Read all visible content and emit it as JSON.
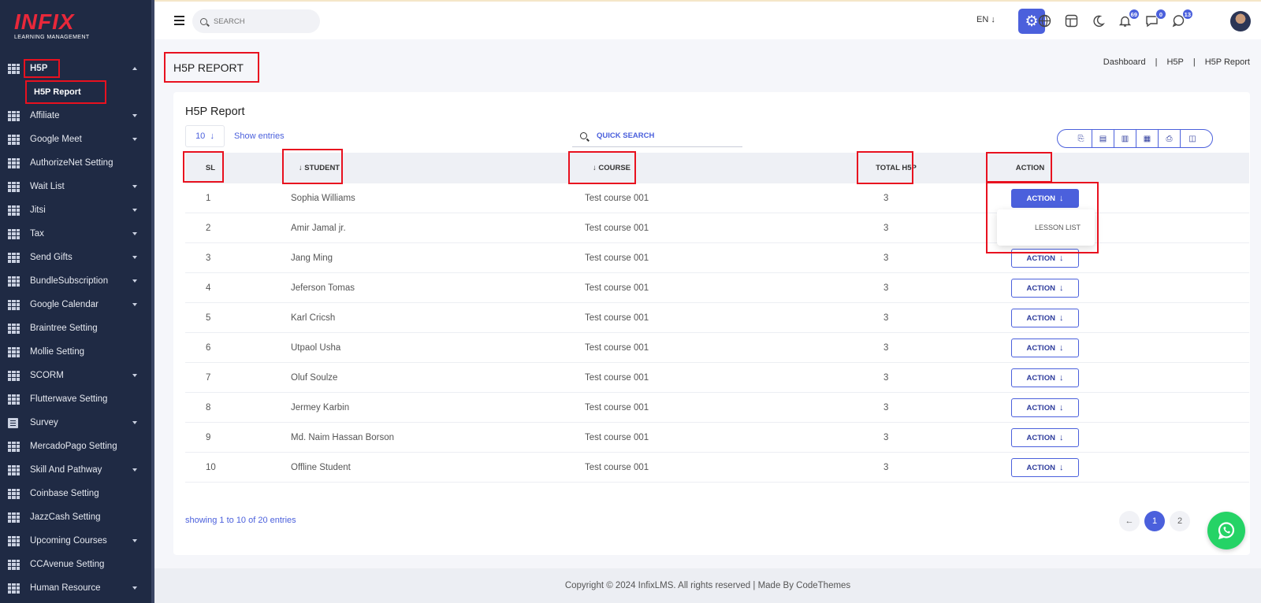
{
  "logo": {
    "main": "INFIX",
    "sub": "LEARNING MANAGEMENT"
  },
  "sidebar": {
    "items": [
      {
        "label": "H5P",
        "caret": "up",
        "icon": "grid-icon"
      },
      {
        "label": "Affiliate",
        "caret": "down",
        "icon": "grid-icon"
      },
      {
        "label": "Google Meet",
        "caret": "down",
        "icon": "grid-icon"
      },
      {
        "label": "AuthorizeNet Setting",
        "caret": "",
        "icon": "grid-icon"
      },
      {
        "label": "Wait List",
        "caret": "down",
        "icon": "grid-icon"
      },
      {
        "label": "Jitsi",
        "caret": "down",
        "icon": "grid-icon"
      },
      {
        "label": "Tax",
        "caret": "down",
        "icon": "grid-icon"
      },
      {
        "label": "Send Gifts",
        "caret": "down",
        "icon": "grid-icon"
      },
      {
        "label": "BundleSubscription",
        "caret": "down",
        "icon": "grid-icon"
      },
      {
        "label": "Google Calendar",
        "caret": "down",
        "icon": "grid-icon"
      },
      {
        "label": "Braintree Setting",
        "caret": "",
        "icon": "grid-icon"
      },
      {
        "label": "Mollie Setting",
        "caret": "",
        "icon": "grid-icon"
      },
      {
        "label": "SCORM",
        "caret": "down",
        "icon": "grid-icon"
      },
      {
        "label": "Flutterwave Setting",
        "caret": "",
        "icon": "grid-icon"
      },
      {
        "label": "Survey",
        "caret": "down",
        "icon": "doc-icon"
      },
      {
        "label": "MercadoPago Setting",
        "caret": "",
        "icon": "grid-icon"
      },
      {
        "label": "Skill And Pathway",
        "caret": "down",
        "icon": "grid-icon"
      },
      {
        "label": "Coinbase Setting",
        "caret": "",
        "icon": "grid-icon"
      },
      {
        "label": "JazzCash Setting",
        "caret": "",
        "icon": "grid-icon"
      },
      {
        "label": "Upcoming Courses",
        "caret": "down",
        "icon": "grid-icon"
      },
      {
        "label": "CCAvenue Setting",
        "caret": "",
        "icon": "grid-icon"
      },
      {
        "label": "Human Resource",
        "caret": "down",
        "icon": "grid-icon"
      }
    ],
    "sub_item": "H5P Report"
  },
  "topbar": {
    "search_placeholder": "SEARCH",
    "lang": "EN",
    "badges": {
      "notifications": "69",
      "messages": "0",
      "whatsapp": "13"
    }
  },
  "page": {
    "title": "H5P REPORT",
    "breadcrumb": [
      "Dashboard",
      "H5P",
      "H5P Report"
    ]
  },
  "card": {
    "title": "H5P Report",
    "entries_value": "10",
    "entries_label": "Show entries",
    "quick_search": "QUICK SEARCH",
    "columns": {
      "sl": "SL",
      "student": "STUDENT",
      "course": "COURSE",
      "total": "TOTAL H5P",
      "action": "ACTION"
    },
    "action_label": "ACTION",
    "dropdown_item": "LESSON LIST",
    "rows": [
      {
        "sl": "1",
        "student": "Sophia Williams",
        "course": "Test course 001",
        "total": "3"
      },
      {
        "sl": "2",
        "student": "Amir Jamal jr.",
        "course": "Test course 001",
        "total": "3"
      },
      {
        "sl": "3",
        "student": "Jang Ming",
        "course": "Test course 001",
        "total": "3"
      },
      {
        "sl": "4",
        "student": "Jeferson Tomas",
        "course": "Test course 001",
        "total": "3"
      },
      {
        "sl": "5",
        "student": "Karl Cricsh",
        "course": "Test course 001",
        "total": "3"
      },
      {
        "sl": "6",
        "student": "Utpaol Usha",
        "course": "Test course 001",
        "total": "3"
      },
      {
        "sl": "7",
        "student": "Oluf Soulze",
        "course": "Test course 001",
        "total": "3"
      },
      {
        "sl": "8",
        "student": "Jermey Karbin",
        "course": "Test course 001",
        "total": "3"
      },
      {
        "sl": "9",
        "student": "Md. Naim Hassan Borson",
        "course": "Test course 001",
        "total": "3"
      },
      {
        "sl": "10",
        "student": "Offline Student",
        "course": "Test course 001",
        "total": "3"
      }
    ],
    "showing": "showing 1 to 10 of 20 entries",
    "pages": [
      "1",
      "2"
    ]
  },
  "footer": "Copyright © 2024 InfixLMS. All rights reserved | Made By CodeThemes",
  "colors": {
    "accent": "#4b60dc",
    "sidebar": "#1f2a44",
    "highlight": "#e8111f",
    "whatsapp": "#25d366"
  }
}
